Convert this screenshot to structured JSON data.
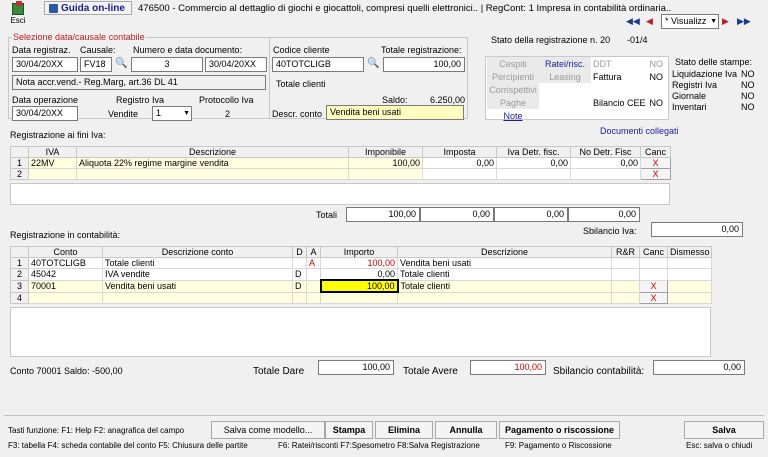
{
  "toolbar": {
    "exit_label": "Esci",
    "guide_label": "Guida on-line",
    "title": "476500 - Commercio al dettaglio di giochi e giocattoli, compresi quelli elettronici.. | RegCont: 1 Impresa  in contabilità ordinaria..",
    "view_select": "* Visualizz"
  },
  "selection": {
    "legend": "Selezione data/causale contabile",
    "reg_date_label": "Data registraz.",
    "reg_date": "30/04/20XX",
    "causal_label": "Causale:",
    "causal": "FV18",
    "docnum_label": "Numero e data documento:",
    "doc_number": "3",
    "doc_date": "30/04/20XX",
    "causal_desc": "Nota accr.vend.- Reg.Marg, art.36 DL 41",
    "op_date_label": "Data operazione",
    "op_date": "30/04/20XX",
    "vat_reg_label": "Registro Iva",
    "vat_reg": "Vendite",
    "vat_reg_num": "1",
    "protocol_label": "Protocollo Iva",
    "protocol": "2"
  },
  "customer": {
    "code_label": "Codice cliente",
    "code": "40TOTCLIGB",
    "total_label": "Totale registrazione:",
    "total": "100,00",
    "name": "Totale clienti",
    "balance_label": "Saldo:",
    "balance": "6.250,00",
    "account_desc_label": "Descr. conto",
    "account_desc": "Vendita beni usati"
  },
  "status": {
    "title": "Stato della registrazione n. 20",
    "page": "-01/4",
    "items": [
      {
        "label": "Cespiti",
        "val": ""
      },
      {
        "label": "Ratei/risc.",
        "val": ""
      },
      {
        "label": "DDT",
        "val": "NO"
      },
      {
        "label": "Percipienti",
        "val": ""
      },
      {
        "label": "Leasing",
        "val": ""
      },
      {
        "label": "Fattura",
        "val": "NO"
      },
      {
        "label": "Corrispettivi",
        "val": ""
      },
      {
        "label": "Paghe",
        "val": ""
      },
      {
        "label": "Bilancio CEE",
        "val": "NO"
      },
      {
        "label": "Note",
        "val": ""
      }
    ],
    "prints_title": "Stato delle stampe:",
    "prints": [
      {
        "label": "Liquidazione Iva",
        "val": "NO"
      },
      {
        "label": "Registri Iva",
        "val": "NO"
      },
      {
        "label": "Giornale",
        "val": "NO"
      },
      {
        "label": "Inventari",
        "val": "NO"
      }
    ],
    "linked_docs": "Documenti collegati"
  },
  "vat": {
    "title": "Registrazione ai fini Iva:",
    "headers": [
      "IVA",
      "Descrizione",
      "Imponibile",
      "Imposta",
      "Iva Detr. fisc.",
      "No Detr. Fisc",
      "Canc"
    ],
    "rows": [
      {
        "n": "1",
        "iva": "22MV",
        "desc": "Aliquota 22% regime margine vendita",
        "imp": "100,00",
        "tax": "0,00",
        "detr": "0,00",
        "nodetr": "0,00",
        "x": "X"
      },
      {
        "n": "2",
        "iva": "",
        "desc": "",
        "imp": "",
        "tax": "",
        "detr": "",
        "nodetr": "",
        "x": "X"
      }
    ],
    "totals_label": "Totali",
    "totals": [
      "100,00",
      "0,00",
      "0,00",
      "0,00"
    ],
    "imbalance_label": "Sbilancio Iva:",
    "imbalance": "0,00"
  },
  "acc": {
    "title": "Registrazione in contabilità:",
    "headers": [
      "Conto",
      "Descrizione conto",
      "D",
      "A",
      "Importo",
      "Descrizione",
      "R&R",
      "Canc",
      "Dismesso"
    ],
    "rows": [
      {
        "n": "1",
        "conto": "40TOTCLIGB",
        "desc": "Totale clienti",
        "d": "",
        "a": "A",
        "imp": "100,00",
        "descr": "Vendita beni usati",
        "x": ""
      },
      {
        "n": "2",
        "conto": "45042",
        "desc": "IVA vendite",
        "d": "D",
        "a": "",
        "imp": "0,00",
        "descr": "Totale clienti",
        "x": ""
      },
      {
        "n": "3",
        "conto": "70001",
        "desc": "Vendita beni usati",
        "d": "D",
        "a": "",
        "imp": "100,00",
        "descr": "Totale clienti",
        "x": "X"
      },
      {
        "n": "4",
        "conto": "",
        "desc": "",
        "d": "",
        "a": "",
        "imp": "",
        "descr": "",
        "x": "X"
      }
    ],
    "account_balance": "Conto 70001 Saldo: -500,00",
    "total_dare_label": "Totale Dare",
    "total_dare": "100,00",
    "total_avere_label": "Totale Avere",
    "total_avere": "100,00",
    "imbalance_label": "Sbilancio contabilità:",
    "imbalance": "0,00"
  },
  "footer": {
    "hotkeys1": "Tasti funzione:  F1: Help  F2: anagrafica del campo",
    "save_model": "Salva come modello...",
    "stampa": "Stampa",
    "elimina": "Elimina",
    "annulla": "Annulla",
    "pagamento": "Pagamento o riscossione",
    "salva": "Salva",
    "hotkeys2": "F3: tabella   F4: scheda contabile del conto   F5: Chiusura delle partite",
    "hotkeys3": "F6: Ratei/risconti   F7:Spesometro   F8:Salva Registrazione",
    "hotkeys4": "F9: Pagamento o Riscossione",
    "hotkeys5": "Esc: salva o chiudi"
  }
}
